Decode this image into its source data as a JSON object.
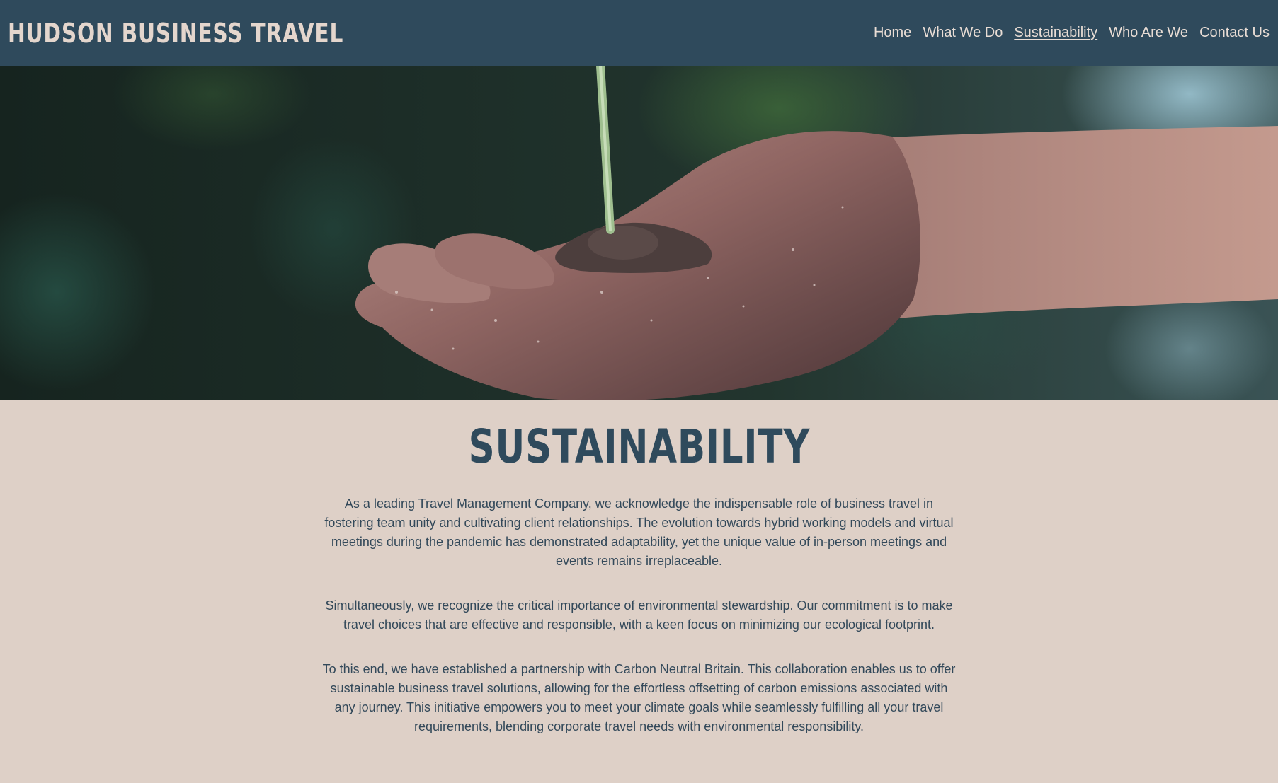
{
  "header": {
    "brand": "HUDSON BUSINESS TRAVEL",
    "nav": [
      {
        "label": "Home",
        "active": false
      },
      {
        "label": "What We Do",
        "active": false
      },
      {
        "label": "Sustainability",
        "active": true
      },
      {
        "label": "Who Are We",
        "active": false
      },
      {
        "label": "Contact Us",
        "active": false
      }
    ]
  },
  "hero": {
    "image": "hand-holding-seedling-photo"
  },
  "main": {
    "title": "SUSTAINABILITY",
    "paragraphs": [
      "As a leading Travel Management Company, we acknowledge the indispensable role of business travel in fostering team unity and cultivating client relationships. The evolution towards hybrid working models and virtual meetings during the pandemic has demonstrated adaptability, yet the unique value of in-person meetings and events remains irreplaceable.",
      "Simultaneously, we recognize the critical importance of environmental stewardship. Our commitment is to make travel choices that are effective and responsible, with a keen focus on minimizing our ecological footprint.",
      "To this end, we have established a partnership with Carbon Neutral Britain. This collaboration enables us to offer sustainable business travel solutions, allowing for the effortless offsetting of carbon emissions associated with any journey. This initiative empowers you to meet your climate goals while seamlessly fulfilling all your travel requirements, blending corporate travel needs with environmental responsibility."
    ]
  },
  "colors": {
    "header_bg": "#2f4a5c",
    "page_bg": "#ded0c7",
    "text": "#33495a",
    "title": "#2f4a5c",
    "brand": "#e4d6cd"
  }
}
